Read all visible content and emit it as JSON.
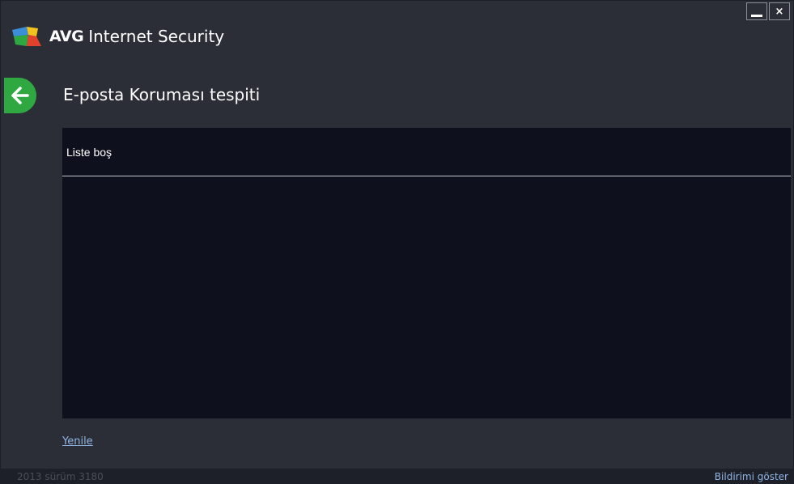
{
  "window": {
    "minimize_icon": "minimize-icon",
    "close_label": "×"
  },
  "header": {
    "brand_avg": "AVG",
    "brand_rest": "Internet Security",
    "logo_icon": "avg-logo-icon"
  },
  "nav": {
    "back_icon": "back-arrow-icon"
  },
  "page": {
    "title": "E-posta Koruması tespiti"
  },
  "list": {
    "empty_message": "Liste boş"
  },
  "actions": {
    "refresh_label": "Yenile"
  },
  "status": {
    "version": "2013 sürüm 3180",
    "notify_label": "Bildirimi göster"
  },
  "colors": {
    "background": "#2c2e37",
    "panel": "#0e101d",
    "accent_green": "#2fa842",
    "link": "#8fb4e3"
  }
}
